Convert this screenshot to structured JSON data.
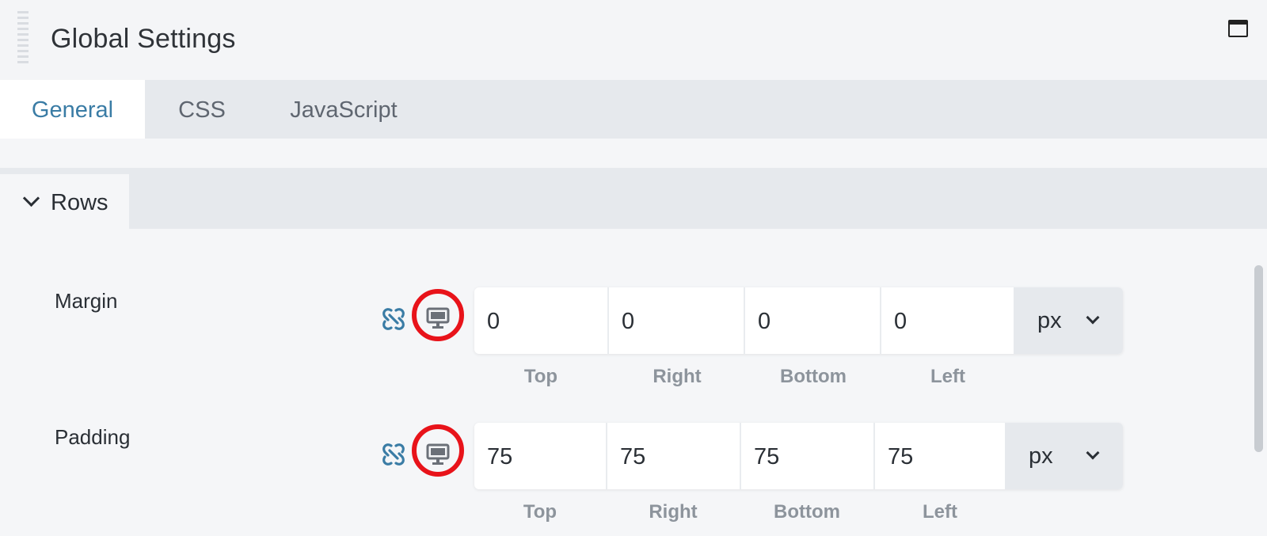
{
  "header": {
    "title": "Global Settings"
  },
  "tabs": [
    {
      "label": "General",
      "active": true
    },
    {
      "label": "CSS",
      "active": false
    },
    {
      "label": "JavaScript",
      "active": false
    }
  ],
  "section": {
    "label": "Rows",
    "expanded": true
  },
  "fields": [
    {
      "label": "Margin",
      "values": [
        "0",
        "0",
        "0",
        "0"
      ],
      "unit": "px",
      "sides": [
        "Top",
        "Right",
        "Bottom",
        "Left"
      ]
    },
    {
      "label": "Padding",
      "values": [
        "75",
        "75",
        "75",
        "75"
      ],
      "unit": "px",
      "sides": [
        "Top",
        "Right",
        "Bottom",
        "Left"
      ]
    }
  ],
  "colors": {
    "accent": "#3a7ca5",
    "highlight_circle": "#e8131a",
    "link_icon": "#3a7ca5"
  },
  "icons": {
    "link": "link-icon",
    "responsive": "desktop-monitor-icon",
    "window": "window-maximize-icon",
    "collapse": "chevron-down-icon"
  }
}
